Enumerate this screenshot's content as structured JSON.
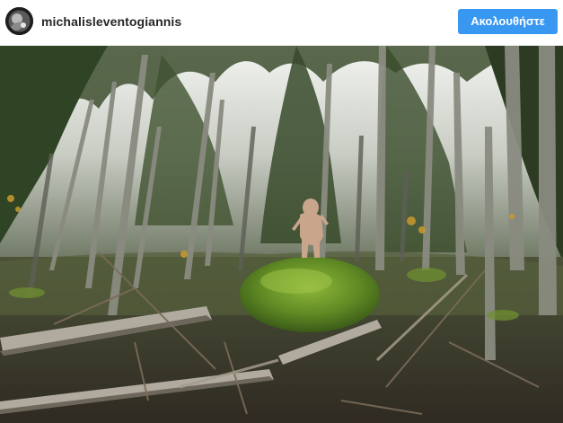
{
  "post": {
    "username": "michalisleventogiannis",
    "follow_label": "Ακολουθήστε",
    "avatar_icon": "user-avatar-photo",
    "photo_icon": "forest-photo"
  },
  "colors": {
    "follow_button": "#3897f0",
    "username_text": "#262626",
    "header_background": "#ffffff"
  }
}
